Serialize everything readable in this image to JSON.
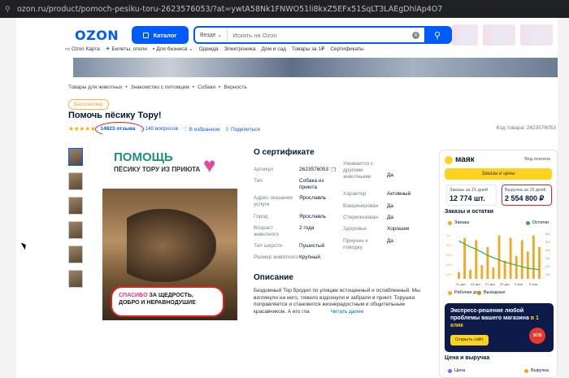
{
  "browser": {
    "url": "ozon.ru/product/pomoch-pesiku-toru-2623576053/?at=ywtA58Nk1FNWO51li8kxZ5EFx51SqLT3LAEgDhlAp4O7"
  },
  "header": {
    "logo": "OZON",
    "catalog_label": "Каталог",
    "search_scope": "Везде",
    "search_placeholder": "Искать на Ozon"
  },
  "subnav": [
    "Ozon Карта",
    "Билеты, отели",
    "Для бизнеса",
    "Одежда",
    "Электроника",
    "Дом и сад",
    "Товары за 1₽",
    "Сертификаты"
  ],
  "breadcrumbs": [
    "Товары для животных",
    "Знакомство с питомцем",
    "Собаки",
    "Верность"
  ],
  "product": {
    "badge": "Бестселлер",
    "title": "Помочь пёсику Тору!",
    "rating_stars": 4.5,
    "reviews": "14823 отзыва",
    "questions": "140 вопросов",
    "favorite": "В избранное",
    "share": "Поделиться",
    "code": "Код товара: 2623576053",
    "image": {
      "headline": "ПОМОЩЬ",
      "subline": "ПЁСИКУ ТОРУ ИЗ ПРИЮТА",
      "thanks_1": "СПАСИБО",
      "thanks_2": "ЗА ЩЕДРОСТЬ,",
      "thanks_3": "ДОБРО И НЕРАВНОДУШИЕ"
    }
  },
  "certificate": {
    "title": "О сертификате",
    "left": [
      {
        "k": "Артикул",
        "v": "2623576053"
      },
      {
        "k": "Тип",
        "v": "Собака из приюта"
      },
      {
        "k": "Адрес оказания услуги",
        "v": "Ярославль"
      },
      {
        "k": "Город",
        "v": "Ярославль"
      },
      {
        "k": "Возраст животного",
        "v": "2 года"
      },
      {
        "k": "Тип шерсти",
        "v": "Пушистый"
      },
      {
        "k": "Размер животного",
        "v": "Крупный"
      }
    ],
    "right": [
      {
        "k": "Уживается с другими животными",
        "v": "Да"
      },
      {
        "k": "Характер",
        "v": "Активный"
      },
      {
        "k": "Вакцинирован",
        "v": "Да"
      },
      {
        "k": "Стерилизован",
        "v": "Да"
      },
      {
        "k": "Здоровье",
        "v": "Хорошее"
      },
      {
        "k": "Приучен к поводку",
        "v": "Да"
      }
    ]
  },
  "description": {
    "title": "Описание",
    "text": "Бездомный Тор бродил по улицам истощенный и ослабленный. Мы взглянули на него, тяжело вздохнули и забрали в приют. Торушка поправляется и становится жизнерадостным и общительным красавчиком. А его гла",
    "read_more": "Читать далее"
  },
  "widget": {
    "brand": "маяк",
    "version": "Вед.плагина",
    "orders_button": "Заказы и цены",
    "orders_label": "Заказы за 15 дней",
    "orders_value": "12 774 шт.",
    "revenue_label": "Выручка за 15 дней",
    "revenue_value": "2 554 800 ₽",
    "section_orders": "Заказы и остатки",
    "legend_orders": "Заказы",
    "legend_stock": "Остатки",
    "y_left": [
      "1 к",
      "800",
      "600",
      "400",
      "200"
    ],
    "y_right": [
      "6 k",
      "5 k",
      "4 k",
      "3 k",
      "2 k",
      "1 k"
    ],
    "x_labels": [
      "21 дек",
      "24 дек",
      "27 дек",
      "30 дек",
      "3 янв",
      "6 янв"
    ],
    "legend_work": "Рабочие дни",
    "legend_weekend": "Выходные",
    "promo_text": "Экспресс-решение любой проблемы вашего магазина",
    "promo_highlight": "в 1 клик",
    "promo_button": "Открыть сайт",
    "promo_badge": "SOS",
    "section_price": "Цена и выручка",
    "legend_price": "Цена",
    "legend_revenue": "Выручка"
  },
  "chart_data": {
    "type": "bar",
    "bars": [
      150,
      900,
      200,
      850,
      300,
      700,
      250,
      950,
      400,
      900,
      500,
      850,
      600,
      950,
      700
    ],
    "line": [
      5000,
      4600,
      4200,
      3900,
      3500,
      3100,
      2800,
      2500,
      2200,
      2000,
      1800,
      1600,
      1400,
      1300,
      1200
    ],
    "colors": {
      "bars": "#f5a623",
      "line": "#2db34a"
    }
  }
}
